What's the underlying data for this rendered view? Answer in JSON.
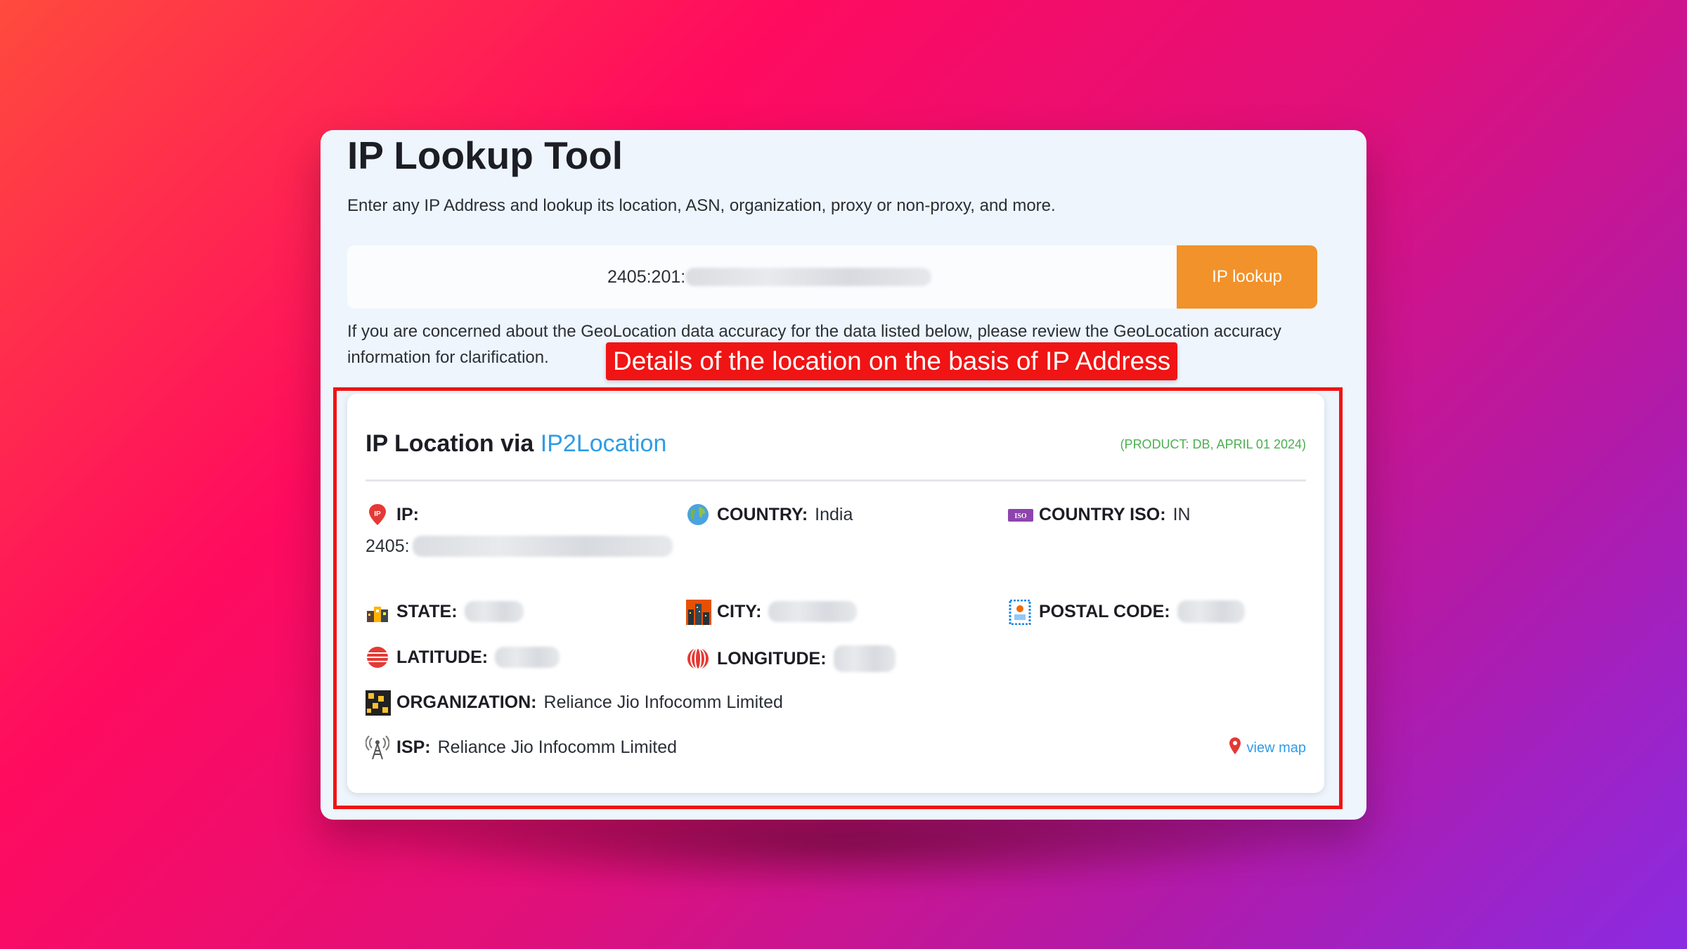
{
  "page": {
    "title": "IP Lookup Tool",
    "subtitle": "Enter any IP Address and lookup its location, ASN, organization, proxy or non-proxy, and more.",
    "notice": "If you are concerned about the GeoLocation data accuracy for the data listed below, please review the GeoLocation accuracy information for clarification."
  },
  "search": {
    "ip_value_visible": "2405:201:",
    "button_label": "IP lookup"
  },
  "callout": {
    "text": "Details of the location on the basis of IP Address",
    "color": "#f01414"
  },
  "card": {
    "title_prefix": "IP Location via",
    "title_link": "IP2Location",
    "product": "(PRODUCT: DB, APRIL 01 2024)",
    "fields": {
      "ip_label": "IP:",
      "ip_value_visible": "2405:",
      "country_label": "COUNTRY:",
      "country_value": "India",
      "country_iso_label": "COUNTRY ISO:",
      "country_iso_value": "IN",
      "state_label": "STATE:",
      "city_label": "CITY:",
      "postal_label": "POSTAL CODE:",
      "latitude_label": "LATITUDE:",
      "longitude_label": "LONGITUDE:",
      "organization_label": "ORGANIZATION:",
      "organization_value": "Reliance Jio Infocomm Limited",
      "isp_label": "ISP:",
      "isp_value": "Reliance Jio Infocomm Limited"
    },
    "view_map": "view map",
    "iso_badge_text": "ISO"
  },
  "colors": {
    "accent_button": "#f2922a",
    "link": "#2f9ce6",
    "product_tag": "#4caf50",
    "highlight": "#f01414"
  },
  "icons": [
    "ip-pin-icon",
    "globe-icon",
    "iso-badge-icon",
    "state-buildings-icon",
    "city-icon",
    "postal-stamp-icon",
    "latitude-icon",
    "longitude-icon",
    "organization-icon",
    "antenna-icon",
    "map-pin-icon"
  ]
}
